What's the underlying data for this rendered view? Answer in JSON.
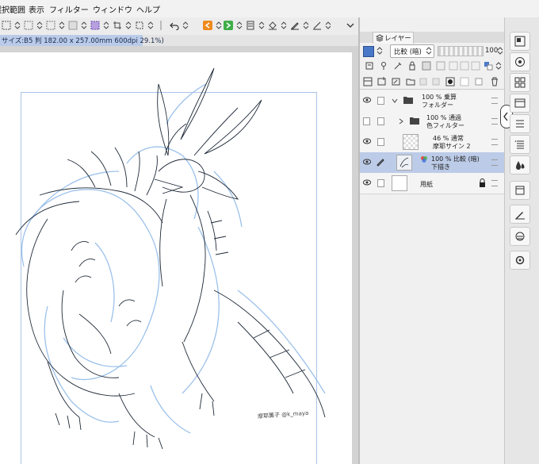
{
  "menu": {
    "items": [
      "選択範囲",
      "表示",
      "フィルター",
      "ウィンドウ",
      "ヘルプ"
    ]
  },
  "document": {
    "tab_label": "サイズ:B5 判 182.00 x 257.00mm 600dpi 29.1%)"
  },
  "layer_panel": {
    "tab_label": "レイヤー",
    "blend_mode": "比較 (暗)",
    "opacity": "100",
    "layers": [
      {
        "line1": "100 % 乗算",
        "line2": "フォルダー",
        "visible": true,
        "selected": false
      },
      {
        "line1": "100 % 通過",
        "line2": "色フィルター",
        "visible": false,
        "selected": false
      },
      {
        "line1": "46 % 通常",
        "line2": "摩耶サイン 2",
        "visible": true,
        "selected": false
      },
      {
        "line1": "100 % 比較 (暗)",
        "line2": "下描き",
        "visible": true,
        "selected": true
      },
      {
        "line1": "",
        "line2": "用紙",
        "visible": true,
        "selected": false
      }
    ]
  },
  "canvas": {
    "signature": "摩耶薫子 @k_maya"
  },
  "colors": {
    "accent": "#4a78c9",
    "selected_layer": "#bccbe7",
    "paper": "#ffffff"
  }
}
